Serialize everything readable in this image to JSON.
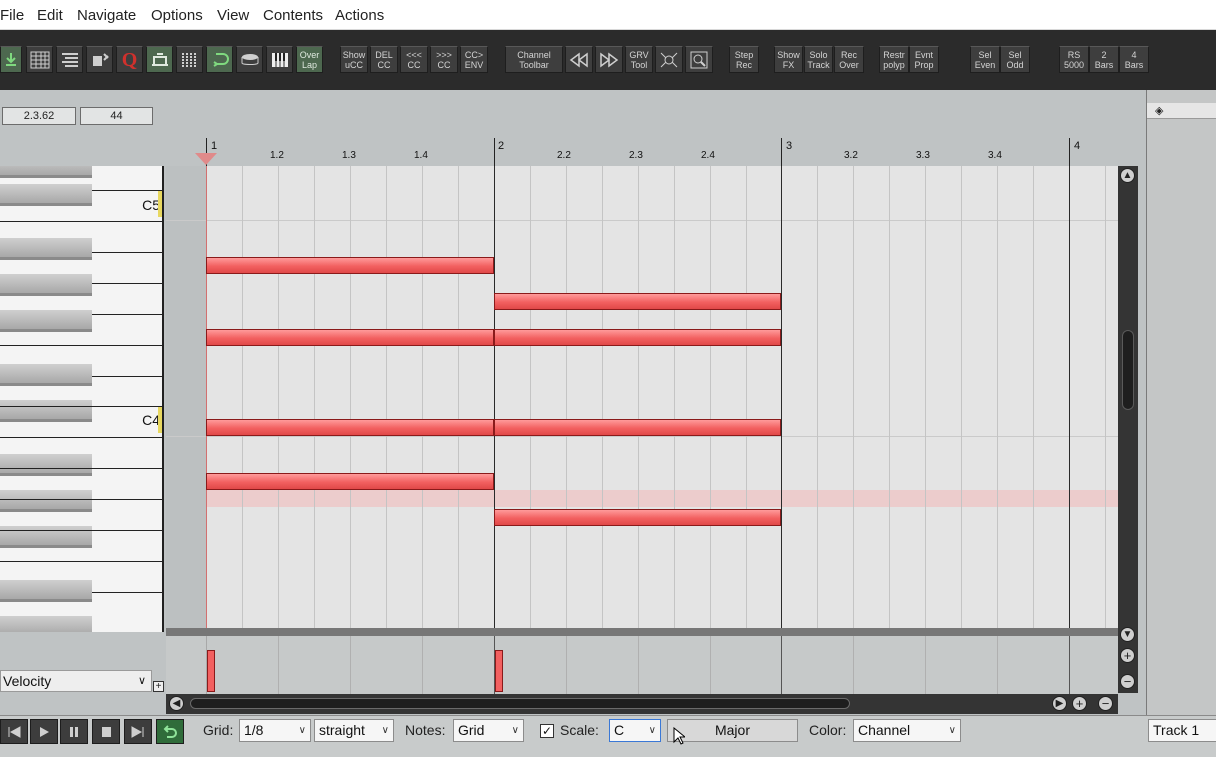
{
  "menu": {
    "items": [
      "File",
      "Edit",
      "Navigate",
      "Options",
      "View",
      "Contents",
      "Actions"
    ]
  },
  "toolbar": {
    "buttons": {
      "overlap": "Over\nLap",
      "show_ucc": "Show\nuCC",
      "del_cc": "DEL\nCC",
      "prev_cc": "<<<\nCC",
      "next_cc": ">>>\nCC",
      "cc_env": "CC>\nENV",
      "channel_toolbar": "Channel\nToolbar",
      "grv_tool": "GRV\nTool",
      "step_rec": "Step\nRec",
      "show_fx": "Show\nFX",
      "solo_track": "Solo\nTrack",
      "rec_over": "Rec\nOver",
      "restr_polyp": "Restr\npolyp",
      "evnt_prop": "Evnt\nProp",
      "sel_even": "Sel\nEven",
      "sel_odd": "Sel\nOdd",
      "rs_5000": "RS\n5000",
      "two_bars": "2\nBars",
      "four_bars": "4\nBars"
    },
    "q_glyph": "Q"
  },
  "fields": {
    "position": "2.3.62",
    "velocity": "44"
  },
  "ruler": {
    "labels": [
      "1",
      "1.2",
      "1.3",
      "1.4",
      "2",
      "2.2",
      "2.3",
      "2.4",
      "3",
      "3.2",
      "3.3",
      "3.4",
      "4"
    ]
  },
  "keyboard": {
    "labels": [
      "C5",
      "C4"
    ]
  },
  "notes": [
    {
      "pitch": "A#4",
      "start": 1.0,
      "end": 2.0
    },
    {
      "pitch": "A4",
      "start": 2.0,
      "end": 3.0
    },
    {
      "pitch": "G#4",
      "start": 1.0,
      "end": 2.0
    },
    {
      "pitch": "G#4",
      "start": 2.0,
      "end": 3.0
    },
    {
      "pitch": "C4",
      "start": 1.0,
      "end": 2.0
    },
    {
      "pitch": "C4",
      "start": 2.0,
      "end": 3.0
    },
    {
      "pitch": "A#3",
      "start": 1.0,
      "end": 2.0
    },
    {
      "pitch": "G#3",
      "start": 2.0,
      "end": 3.0
    }
  ],
  "cc_lane": {
    "selector": "Velocity"
  },
  "bottom": {
    "grid_label": "Grid:",
    "grid_value": "1/8",
    "swing_value": "straight",
    "notes_label": "Notes:",
    "notes_value": "Grid",
    "scale_label": "Scale:",
    "scale_root": "C",
    "scale_type": "Major",
    "color_label": "Color:",
    "color_value": "Channel",
    "track_name": "Track 1"
  },
  "colors": {
    "note": "#f26060",
    "toolbar": "#2b2b2b",
    "accent": "#e8d860"
  }
}
